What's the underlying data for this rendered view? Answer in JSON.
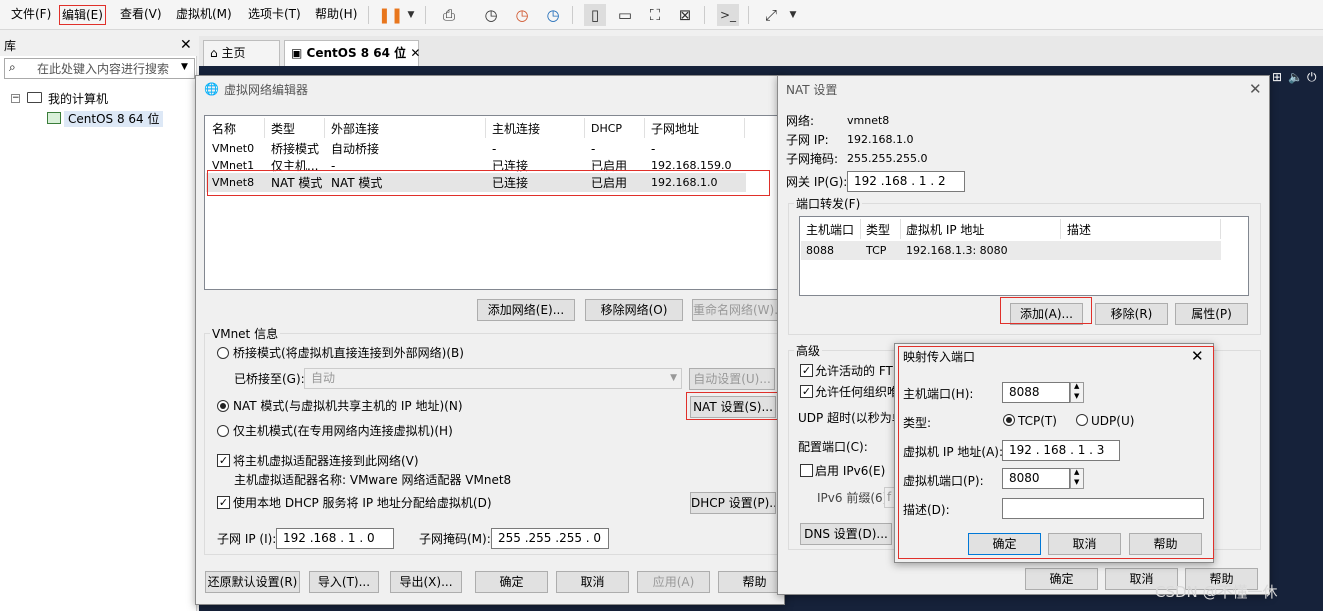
{
  "menu": [
    "文件(F)",
    "编辑(E)",
    "查看(V)",
    "虚拟机(M)",
    "选项卡(T)",
    "帮助(H)"
  ],
  "library": {
    "title": "库",
    "search_placeholder": "在此处键入内容进行搜索",
    "root": "我的计算机",
    "vm": "CentOS 8 64 位"
  },
  "tabs": {
    "home": "主页",
    "vm": "CentOS 8 64 位"
  },
  "vne": {
    "title": "虚拟网络编辑器",
    "columns": [
      "名称",
      "类型",
      "外部连接",
      "主机连接",
      "DHCP",
      "子网地址"
    ],
    "rows": [
      [
        "VMnet0",
        "桥接模式",
        "自动桥接",
        "-",
        "-",
        "-"
      ],
      [
        "VMnet1",
        "仅主机...",
        "-",
        "已连接",
        "已启用",
        "192.168.159.0"
      ],
      [
        "VMnet8",
        "NAT 模式",
        "NAT 模式",
        "已连接",
        "已启用",
        "192.168.1.0"
      ]
    ],
    "add_net": "添加网络(E)...",
    "remove_net": "移除网络(O)",
    "rename_net": "重命名网络(W)...",
    "info_title": "VMnet 信息",
    "bridge_radio": "桥接模式(将虚拟机直接连接到外部网络)(B)",
    "bridged_to_label": "已桥接至(G):",
    "bridged_to_value": "自动",
    "auto_settings": "自动设置(U)...",
    "nat_radio": "NAT 模式(与虚拟机共享主机的 IP 地址)(N)",
    "nat_settings": "NAT 设置(S)...",
    "host_radio": "仅主机模式(在专用网络内连接虚拟机)(H)",
    "connect_adapter": "将主机虚拟适配器连接到此网络(V)",
    "adapter_name": "主机虚拟适配器名称: VMware 网络适配器 VMnet8",
    "use_dhcp": "使用本地 DHCP 服务将 IP 地址分配给虚拟机(D)",
    "dhcp_settings": "DHCP 设置(P)...",
    "subnet_ip_label": "子网 IP (I):",
    "subnet_ip": "192 .168 . 1 . 0",
    "subnet_mask_label": "子网掩码(M):",
    "subnet_mask": "255 .255 .255 . 0",
    "restore": "还原默认设置(R)",
    "import": "导入(T)...",
    "export": "导出(X)...",
    "ok": "确定",
    "cancel": "取消",
    "apply": "应用(A)",
    "help": "帮助"
  },
  "nat": {
    "title": "NAT 设置",
    "network_label": "网络:",
    "network": "vmnet8",
    "subnet_ip_label": "子网 IP:",
    "subnet_ip": "192.168.1.0",
    "subnet_mask_label": "子网掩码:",
    "subnet_mask": "255.255.255.0",
    "gateway_label": "网关 IP(G):",
    "gateway": "192 .168 . 1 . 2",
    "port_fwd": "端口转发(F)",
    "pf_columns": [
      "主机端口",
      "类型",
      "虚拟机 IP 地址",
      "描述"
    ],
    "pf_row": [
      "8088",
      "TCP",
      "192.168.1.3: 8080",
      ""
    ],
    "add": "添加(A)...",
    "remove": "移除(R)",
    "props": "属性(P)",
    "advanced": "高级",
    "allow_ftp": "允许活动的 FTP",
    "allow_org": "允许任何组织唯",
    "udp_timeout": "UDP 超时(以秒为单",
    "config_port": "配置端口(C):",
    "enable_ipv6": "启用 IPv6(E)",
    "ipv6_prefix": "IPv6 前缀(6):",
    "ipv6_value": "f",
    "dns": "DNS 设置(D)...",
    "ok": "确定",
    "cancel": "取消",
    "help": "帮助"
  },
  "port": {
    "title": "映射传入端口",
    "host_port_label": "主机端口(H):",
    "host_port": "8088",
    "type_label": "类型:",
    "tcp": "TCP(T)",
    "udp": "UDP(U)",
    "vm_ip_label": "虚拟机 IP 地址(A):",
    "vm_ip": "192 . 168 . 1 . 3",
    "vm_port_label": "虚拟机端口(P):",
    "vm_port": "8080",
    "desc_label": "描述(D):",
    "desc": "",
    "ok": "确定",
    "cancel": "取消",
    "help": "帮助"
  },
  "watermark": "CSDN @不懂一休"
}
